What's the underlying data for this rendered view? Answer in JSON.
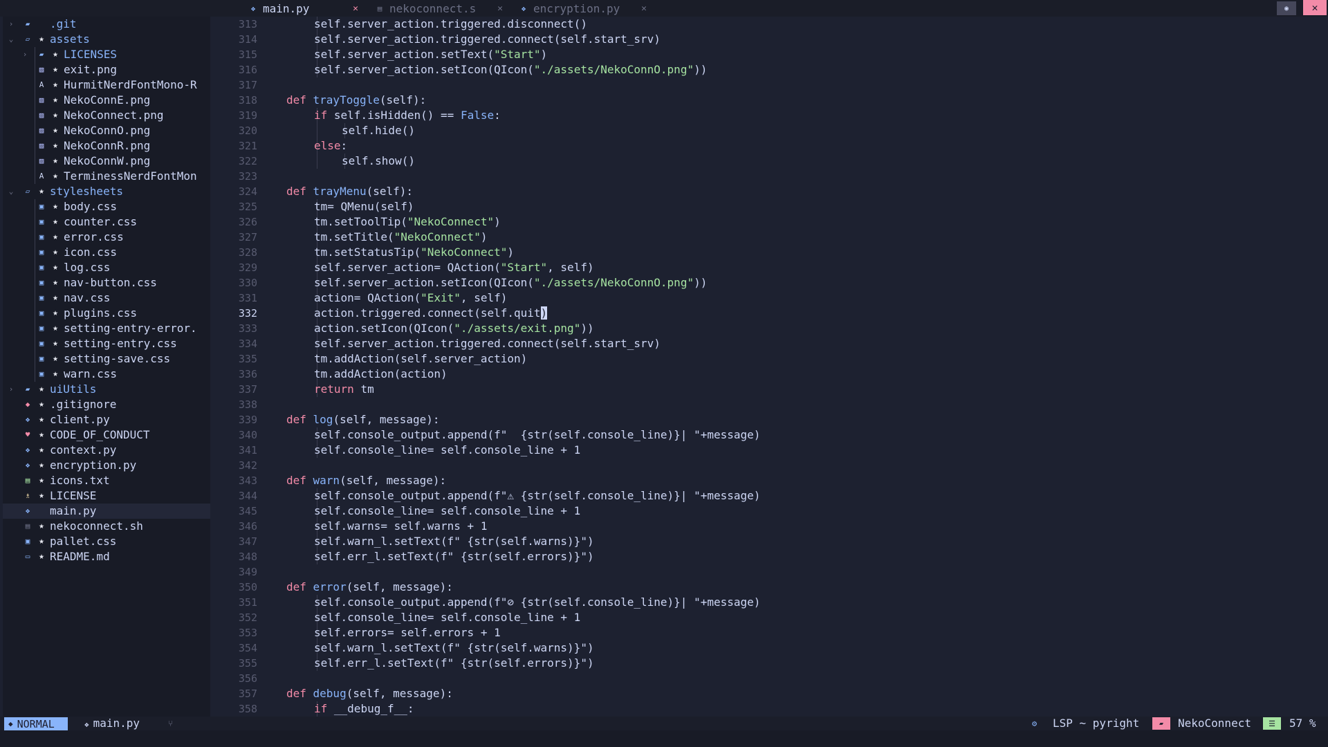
{
  "colors": {
    "background": "#1d2130",
    "keyword": "#f38ba8",
    "function": "#89b4fa",
    "string": "#a6e3a1",
    "folder": "#89b4fa",
    "accent_close": "#f38ba8"
  },
  "tabs": [
    {
      "label": "main.py",
      "icon": "python-icon",
      "active": true
    },
    {
      "label": "nekoconnect.s",
      "icon": "shell-icon",
      "active": false
    },
    {
      "label": "encryption.py",
      "icon": "python-icon",
      "active": false
    }
  ],
  "tree": [
    {
      "name": ".git",
      "icon": "folder",
      "depth": 0,
      "chevron": "closed",
      "starred": false
    },
    {
      "name": "assets",
      "icon": "folder-open",
      "depth": 0,
      "chevron": "open",
      "starred": true
    },
    {
      "name": "LICENSES",
      "icon": "folder",
      "depth": 1,
      "chevron": "closed",
      "starred": true
    },
    {
      "name": "exit.png",
      "icon": "image",
      "depth": 1,
      "starred": true
    },
    {
      "name": "HurmitNerdFontMono-R",
      "icon": "font",
      "depth": 1,
      "starred": true
    },
    {
      "name": "NekoConnE.png",
      "icon": "image",
      "depth": 1,
      "starred": true
    },
    {
      "name": "NekoConnect.png",
      "icon": "image",
      "depth": 1,
      "starred": true
    },
    {
      "name": "NekoConnO.png",
      "icon": "image",
      "depth": 1,
      "starred": true
    },
    {
      "name": "NekoConnR.png",
      "icon": "image",
      "depth": 1,
      "starred": true
    },
    {
      "name": "NekoConnW.png",
      "icon": "image",
      "depth": 1,
      "starred": true
    },
    {
      "name": "TerminessNerdFontMon",
      "icon": "font",
      "depth": 1,
      "starred": true
    },
    {
      "name": "stylesheets",
      "icon": "folder-open",
      "depth": 0,
      "chevron": "open",
      "starred": true
    },
    {
      "name": "body.css",
      "icon": "css",
      "depth": 1,
      "starred": true
    },
    {
      "name": "counter.css",
      "icon": "css",
      "depth": 1,
      "starred": true
    },
    {
      "name": "error.css",
      "icon": "css",
      "depth": 1,
      "starred": true
    },
    {
      "name": "icon.css",
      "icon": "css",
      "depth": 1,
      "starred": true
    },
    {
      "name": "log.css",
      "icon": "css",
      "depth": 1,
      "starred": true
    },
    {
      "name": "nav-button.css",
      "icon": "css",
      "depth": 1,
      "starred": true
    },
    {
      "name": "nav.css",
      "icon": "css",
      "depth": 1,
      "starred": true
    },
    {
      "name": "plugins.css",
      "icon": "css",
      "depth": 1,
      "starred": true
    },
    {
      "name": "setting-entry-error.",
      "icon": "css",
      "depth": 1,
      "starred": true
    },
    {
      "name": "setting-entry.css",
      "icon": "css",
      "depth": 1,
      "starred": true
    },
    {
      "name": "setting-save.css",
      "icon": "css",
      "depth": 1,
      "starred": true
    },
    {
      "name": "warn.css",
      "icon": "css",
      "depth": 1,
      "starred": true
    },
    {
      "name": "uiUtils",
      "icon": "folder",
      "depth": 0,
      "chevron": "closed",
      "starred": true
    },
    {
      "name": ".gitignore",
      "icon": "git",
      "depth": 0,
      "starred": true
    },
    {
      "name": "client.py",
      "icon": "python",
      "depth": 0,
      "starred": true
    },
    {
      "name": "CODE_OF_CONDUCT",
      "icon": "heart",
      "depth": 0,
      "starred": true
    },
    {
      "name": "context.py",
      "icon": "python",
      "depth": 0,
      "starred": true
    },
    {
      "name": "encryption.py",
      "icon": "python",
      "depth": 0,
      "starred": true
    },
    {
      "name": "icons.txt",
      "icon": "text",
      "depth": 0,
      "starred": true
    },
    {
      "name": "LICENSE",
      "icon": "license",
      "depth": 0,
      "starred": true
    },
    {
      "name": "main.py",
      "icon": "python",
      "depth": 0,
      "starred": false,
      "selected": true
    },
    {
      "name": "nekoconnect.sh",
      "icon": "shell",
      "depth": 0,
      "starred": true
    },
    {
      "name": "pallet.css",
      "icon": "css",
      "depth": 0,
      "starred": true
    },
    {
      "name": "README.md",
      "icon": "markdown",
      "depth": 0,
      "starred": true
    }
  ],
  "editor": {
    "current_line": 332,
    "lines": [
      {
        "n": 313,
        "indent": 2,
        "tokens": [
          [
            "self.server_action.triggered.disconnect()",
            ""
          ]
        ]
      },
      {
        "n": 314,
        "indent": 2,
        "tokens": [
          [
            "self.server_action.triggered.connect(self.start_srv)",
            ""
          ]
        ]
      },
      {
        "n": 315,
        "indent": 2,
        "tokens": [
          [
            "self.server_action.setText(",
            ""
          ],
          [
            "\"Start\"",
            "str"
          ],
          [
            ")",
            ""
          ]
        ]
      },
      {
        "n": 316,
        "indent": 2,
        "tokens": [
          [
            "self.server_action.setIcon(QIcon(",
            ""
          ],
          [
            "\"./assets/NekoConnO.png\"",
            "str"
          ],
          [
            "))",
            ""
          ]
        ]
      },
      {
        "n": 317,
        "indent": 0,
        "tokens": []
      },
      {
        "n": 318,
        "indent": 1,
        "tokens": [
          [
            "def ",
            "kw"
          ],
          [
            "trayToggle",
            "fn"
          ],
          [
            "(self):",
            ""
          ]
        ]
      },
      {
        "n": 319,
        "indent": 2,
        "tokens": [
          [
            "if ",
            "kw"
          ],
          [
            "self.isHidden() == ",
            ""
          ],
          [
            "False",
            "fn"
          ],
          [
            ":",
            ""
          ]
        ]
      },
      {
        "n": 320,
        "indent": 3,
        "tokens": [
          [
            "self.hide()",
            ""
          ]
        ]
      },
      {
        "n": 321,
        "indent": 2,
        "tokens": [
          [
            "else",
            "kw"
          ],
          [
            ":",
            ""
          ]
        ]
      },
      {
        "n": 322,
        "indent": 3,
        "tokens": [
          [
            "self.show()",
            ""
          ]
        ]
      },
      {
        "n": 323,
        "indent": 0,
        "tokens": []
      },
      {
        "n": 324,
        "indent": 1,
        "tokens": [
          [
            "def ",
            "kw"
          ],
          [
            "trayMenu",
            "fn"
          ],
          [
            "(self):",
            ""
          ]
        ]
      },
      {
        "n": 325,
        "indent": 2,
        "tokens": [
          [
            "tm= QMenu(self)",
            ""
          ]
        ]
      },
      {
        "n": 326,
        "indent": 2,
        "tokens": [
          [
            "tm.setToolTip(",
            ""
          ],
          [
            "\"NekoConnect\"",
            "str"
          ],
          [
            ")",
            ""
          ]
        ]
      },
      {
        "n": 327,
        "indent": 2,
        "tokens": [
          [
            "tm.setTitle(",
            ""
          ],
          [
            "\"NekoConnect\"",
            "str"
          ],
          [
            ")",
            ""
          ]
        ]
      },
      {
        "n": 328,
        "indent": 2,
        "tokens": [
          [
            "tm.setStatusTip(",
            ""
          ],
          [
            "\"NekoConnect\"",
            "str"
          ],
          [
            ")",
            ""
          ]
        ]
      },
      {
        "n": 329,
        "indent": 2,
        "tokens": [
          [
            "self.server_action= QAction(",
            ""
          ],
          [
            "\"Start\"",
            "str"
          ],
          [
            ", self)",
            ""
          ]
        ]
      },
      {
        "n": 330,
        "indent": 2,
        "tokens": [
          [
            "self.server_action.setIcon(QIcon(",
            ""
          ],
          [
            "\"./assets/NekoConnO.png\"",
            "str"
          ],
          [
            "))",
            ""
          ]
        ]
      },
      {
        "n": 331,
        "indent": 2,
        "tokens": [
          [
            "action= QAction(",
            ""
          ],
          [
            "\"Exit\"",
            "str"
          ],
          [
            ", self)",
            ""
          ]
        ]
      },
      {
        "n": 332,
        "indent": 2,
        "tokens": [
          [
            "action.triggered.connect(self.quit",
            ""
          ],
          [
            ")",
            "cursor"
          ]
        ]
      },
      {
        "n": 333,
        "indent": 2,
        "tokens": [
          [
            "action.setIcon(QIcon(",
            ""
          ],
          [
            "\"./assets/exit.png\"",
            "str"
          ],
          [
            "))",
            ""
          ]
        ]
      },
      {
        "n": 334,
        "indent": 2,
        "tokens": [
          [
            "self.server_action.triggered.connect(self.start_srv)",
            ""
          ]
        ]
      },
      {
        "n": 335,
        "indent": 2,
        "tokens": [
          [
            "tm.addAction(self.server_action)",
            ""
          ]
        ]
      },
      {
        "n": 336,
        "indent": 2,
        "tokens": [
          [
            "tm.addAction(action)",
            ""
          ]
        ]
      },
      {
        "n": 337,
        "indent": 2,
        "tokens": [
          [
            "return ",
            "kw"
          ],
          [
            "tm",
            ""
          ]
        ]
      },
      {
        "n": 338,
        "indent": 0,
        "tokens": []
      },
      {
        "n": 339,
        "indent": 1,
        "tokens": [
          [
            "def ",
            "kw"
          ],
          [
            "log",
            "fn"
          ],
          [
            "(self, message):",
            ""
          ]
        ]
      },
      {
        "n": 340,
        "indent": 2,
        "tokens": [
          [
            "self.console_output.append(f\"  {str(self.console_line)}| \"+message)",
            ""
          ]
        ]
      },
      {
        "n": 341,
        "indent": 2,
        "tokens": [
          [
            "self.console_line= self.console_line + 1",
            ""
          ]
        ]
      },
      {
        "n": 342,
        "indent": 0,
        "tokens": []
      },
      {
        "n": 343,
        "indent": 1,
        "tokens": [
          [
            "def ",
            "kw"
          ],
          [
            "warn",
            "fn"
          ],
          [
            "(self, message):",
            ""
          ]
        ]
      },
      {
        "n": 344,
        "indent": 2,
        "tokens": [
          [
            "self.console_output.append(f\"⚠ {str(self.console_line)}| \"+message)",
            ""
          ]
        ]
      },
      {
        "n": 345,
        "indent": 2,
        "tokens": [
          [
            "self.console_line= self.console_line + 1",
            ""
          ]
        ]
      },
      {
        "n": 346,
        "indent": 2,
        "tokens": [
          [
            "self.warns= self.warns + 1",
            ""
          ]
        ]
      },
      {
        "n": 347,
        "indent": 2,
        "tokens": [
          [
            "self.warn_l.setText(f\" {str(self.warns)}\")",
            ""
          ]
        ]
      },
      {
        "n": 348,
        "indent": 2,
        "tokens": [
          [
            "self.err_l.setText(f\" {str(self.errors)}\")",
            ""
          ]
        ]
      },
      {
        "n": 349,
        "indent": 0,
        "tokens": []
      },
      {
        "n": 350,
        "indent": 1,
        "tokens": [
          [
            "def ",
            "kw"
          ],
          [
            "error",
            "fn"
          ],
          [
            "(self, message):",
            ""
          ]
        ]
      },
      {
        "n": 351,
        "indent": 2,
        "tokens": [
          [
            "self.console_output.append(f\"⊘ {str(self.console_line)}| \"+message)",
            ""
          ]
        ]
      },
      {
        "n": 352,
        "indent": 2,
        "tokens": [
          [
            "self.console_line= self.console_line + 1",
            ""
          ]
        ]
      },
      {
        "n": 353,
        "indent": 2,
        "tokens": [
          [
            "self.errors= self.errors + 1",
            ""
          ]
        ]
      },
      {
        "n": 354,
        "indent": 2,
        "tokens": [
          [
            "self.warn_l.setText(f\" {str(self.warns)}\")",
            ""
          ]
        ]
      },
      {
        "n": 355,
        "indent": 2,
        "tokens": [
          [
            "self.err_l.setText(f\" {str(self.errors)}\")",
            ""
          ]
        ]
      },
      {
        "n": 356,
        "indent": 0,
        "tokens": []
      },
      {
        "n": 357,
        "indent": 1,
        "tokens": [
          [
            "def ",
            "kw"
          ],
          [
            "debug",
            "fn"
          ],
          [
            "(self, message):",
            ""
          ]
        ]
      },
      {
        "n": 358,
        "indent": 2,
        "tokens": [
          [
            "if ",
            "kw"
          ],
          [
            "__debug_f__:",
            ""
          ]
        ]
      }
    ]
  },
  "status": {
    "mode": "NORMAL",
    "mode_icon": "vim-icon",
    "file": "main.py",
    "file_icon": "python-icon",
    "branch_icon": "git-branch-icon",
    "lsp_icon": "gear-icon",
    "lsp": "LSP ~ pyright",
    "project_icon": "folder-icon",
    "project": "NekoConnect",
    "scroll_icon": "lines-icon",
    "scroll_percent": "57 %"
  }
}
